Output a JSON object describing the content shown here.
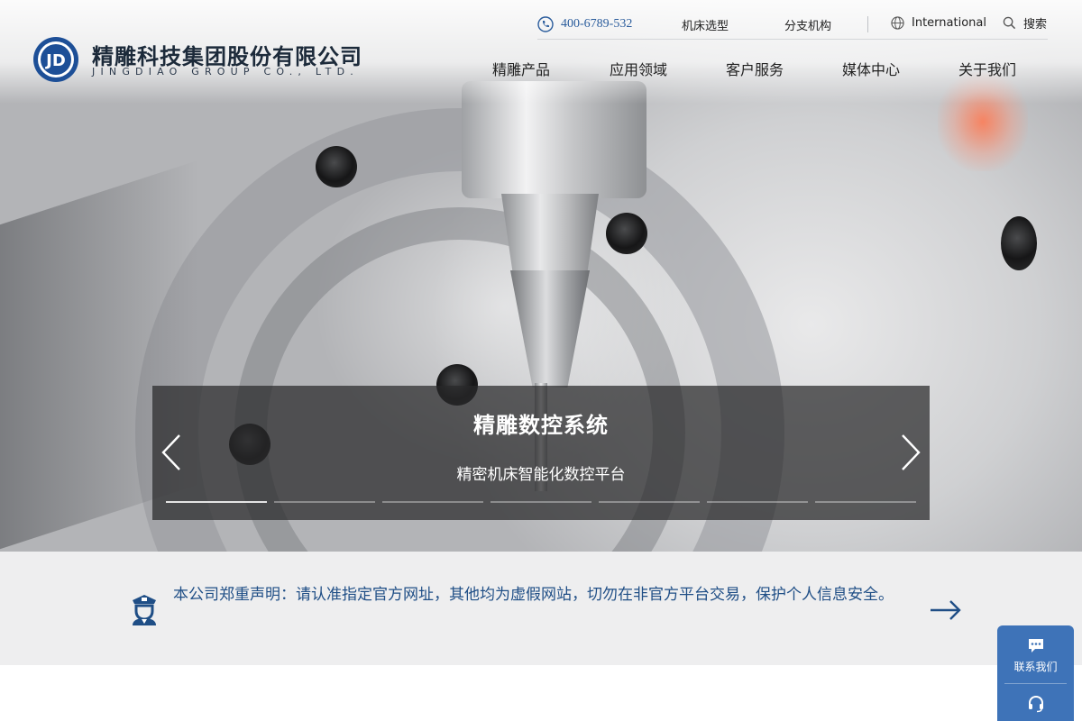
{
  "header": {
    "logo": {
      "mark_text": "JD",
      "name_cn": "精雕科技集团股份有限公司",
      "name_en": "JINGDIAO GROUP CO., LTD."
    },
    "topbar": {
      "phone": "400-6789-532",
      "machine_selection": "机床选型",
      "branches": "分支机构",
      "international": "International",
      "search": "搜索"
    },
    "nav": [
      {
        "label": "精雕产品"
      },
      {
        "label": "应用领域"
      },
      {
        "label": "客户服务"
      },
      {
        "label": "媒体中心"
      },
      {
        "label": "关于我们"
      }
    ]
  },
  "hero": {
    "slide_title": "精雕数控系统",
    "slide_subtitle": "精密机床智能化数控平台",
    "slide_count": 7,
    "active_slide": 1
  },
  "notice": {
    "text": "本公司郑重声明：请认准指定官方网址，其他均为虚假网站，切勿在非官方平台交易，保护个人信息安全。"
  },
  "side_widget": {
    "contact": "联系我们"
  },
  "colors": {
    "brand_blue": "#1f4e86",
    "widget_blue": "#3e73b8",
    "notice_bg": "#eeeeef"
  },
  "icons": [
    "phone-icon",
    "globe-icon",
    "search-icon",
    "chevron-left-icon",
    "chevron-right-icon",
    "security-guard-icon",
    "arrow-right-icon",
    "chat-icon",
    "headset-icon"
  ]
}
